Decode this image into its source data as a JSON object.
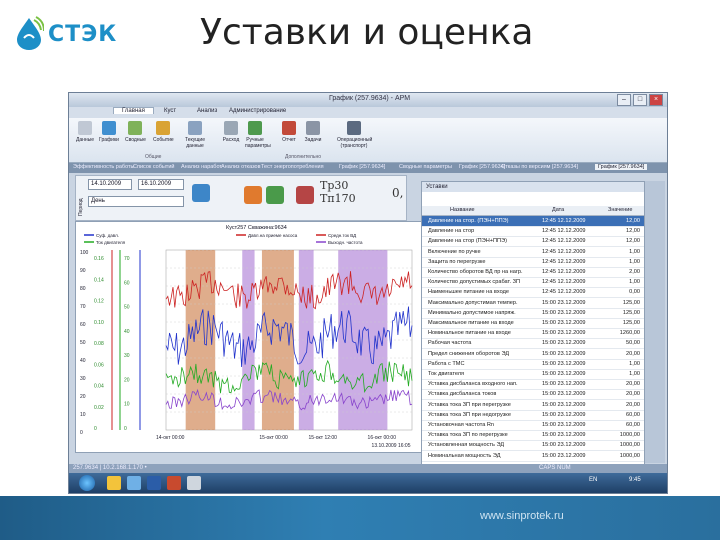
{
  "slide": {
    "title": "Уставки и оценка",
    "logo_text": "СТЭК",
    "footer_url": "www.sinprotek.ru"
  },
  "window": {
    "title": "График (257.9634) - APM",
    "ribbon_tabs": [
      "Главная",
      "Куст",
      "Анализ",
      "Администрирование"
    ],
    "ribbon_buttons": [
      {
        "label": "Данные",
        "color": "#c0c8d4"
      },
      {
        "label": "Графики",
        "color": "#3f8fd0"
      },
      {
        "label": "Сводные",
        "color": "#7fb25a"
      },
      {
        "label": "Событие",
        "color": "#d9a334"
      },
      {
        "label": "Текущие данные",
        "color": "#8aa2c0"
      },
      {
        "label": "Расход",
        "color": "#9aa7b5"
      },
      {
        "label": "Ручные параметры",
        "color": "#4e9a4e"
      },
      {
        "label": "Отчет",
        "color": "#c24a3a"
      },
      {
        "label": "Задачи",
        "color": "#8b95a5"
      },
      {
        "label": "Операционный (транспорт)",
        "color": "#5b6a80"
      }
    ],
    "ribbon_groups": [
      "Общие",
      "Дополнительно"
    ],
    "doc_tabs": [
      "Эффективность работы",
      "Список событий",
      "Анализ наработ",
      "Анализ отказов",
      "Тест энергопотребления",
      "График [257.9634]",
      "Сводные параметры",
      "График [257.9634]",
      "Отказы по версиям [257.9634]",
      "График [257.9634]"
    ],
    "status_left": "257.9634 | 10.2.168.1.170 •",
    "status_right": "CAPS NUM",
    "tray_lang": "EN",
    "tray_time": "9:45"
  },
  "controls": {
    "date_from": "14.10.2009",
    "date_to": "16.10.2009",
    "period": "День",
    "tp_label": "Тр30 Тп170",
    "zero_label": "0,"
  },
  "chart": {
    "header": "Куст257 Скважина:9634",
    "legend": [
      "Суф. давл.",
      "Давл.на приеме насоса",
      "Ток двигателя",
      "Средн.ток ВД",
      "Выходн. частота"
    ],
    "x_ticks": [
      "14-окт 00:00",
      "15-окт 00:00",
      "15-окт 12:00",
      "16-окт 00:00"
    ],
    "x_tick2": "13.10.2009 16:05",
    "y_ticks_left": [
      "100",
      "90",
      "80",
      "70",
      "60",
      "50",
      "40",
      "30",
      "20",
      "10",
      "0"
    ],
    "y_ticks_mid": [
      "0.16",
      "0.14",
      "0.12",
      "0.10",
      "0.08",
      "0.06",
      "0.04",
      "0.02",
      "0"
    ],
    "y_ticks_right": [
      "70",
      "60",
      "50",
      "40",
      "30",
      "20",
      "10",
      "0"
    ]
  },
  "settings": {
    "panel_title": "Уставки",
    "columns": [
      "Название",
      "Дата",
      "Значение"
    ],
    "rows": [
      {
        "name": "Давление на стор. (ПЭН+ППЭ)",
        "date": "12:45 12.12.2009",
        "value": "12,00"
      },
      {
        "name": "Давление на стор",
        "date": "12:45 12.12.2009",
        "value": "12,00"
      },
      {
        "name": "Давление на стор (ПЭН+ППЭ)",
        "date": "12:45 12.12.2009",
        "value": "12,00"
      },
      {
        "name": "Включение по ручке",
        "date": "12:45 12.12.2009",
        "value": "1,00"
      },
      {
        "name": "Защита по перегрузке",
        "date": "12:45 12.12.2009",
        "value": "1,00"
      },
      {
        "name": "Количество оборотов ВД пр на нагр.",
        "date": "12:45 12.12.2009",
        "value": "2,00"
      },
      {
        "name": "Количество допустимых срабат. ЗП",
        "date": "12:45 12.12.2009",
        "value": "1,00"
      },
      {
        "name": "Наименьшее питание на входе",
        "date": "12:45 12.12.2009",
        "value": "0,00"
      },
      {
        "name": "Максимально допустимая темпер.",
        "date": "15:00 23.12.2009",
        "value": "125,00"
      },
      {
        "name": "Минимально допустимое напряж.",
        "date": "15:00 23.12.2009",
        "value": "125,00"
      },
      {
        "name": "Максимальное питание на входе",
        "date": "15:00 23.12.2009",
        "value": "125,00"
      },
      {
        "name": "Номинальное питание на входе",
        "date": "15:00 23.12.2009",
        "value": "1260,00"
      },
      {
        "name": "Рабочая частота",
        "date": "15:00 23.12.2009",
        "value": "50,00"
      },
      {
        "name": "Предел снижения оборотов ЭД",
        "date": "15:00 23.12.2009",
        "value": "20,00"
      },
      {
        "name": "Работа с ТМС",
        "date": "15:00 23.12.2009",
        "value": "1,00"
      },
      {
        "name": "Ток двигателя",
        "date": "15:00 23.12.2009",
        "value": "1,00"
      },
      {
        "name": "Уставка дисбаланса входного нап.",
        "date": "15:00 23.12.2009",
        "value": "20,00"
      },
      {
        "name": "Уставка дисбаланса токов",
        "date": "15:00 23.12.2009",
        "value": "20,00"
      },
      {
        "name": "Уставка тока ЗП при перегрузке",
        "date": "15:00 23.12.2009",
        "value": "20,00"
      },
      {
        "name": "Уставка тока ЗП при недогрузке",
        "date": "15:00 23.12.2009",
        "value": "60,00"
      },
      {
        "name": "Установочная частота Rn",
        "date": "15:00 23.12.2009",
        "value": "60,00"
      },
      {
        "name": "Уставка тока ЗП по перегрузке",
        "date": "15:00 23.12.2009",
        "value": "1000,00"
      },
      {
        "name": "Установленная мощность ЭД",
        "date": "15:00 23.12.2009",
        "value": "1000,00"
      },
      {
        "name": "Номинальная мощность ЭД",
        "date": "15:00 23.12.2009",
        "value": "1000,00"
      }
    ]
  }
}
